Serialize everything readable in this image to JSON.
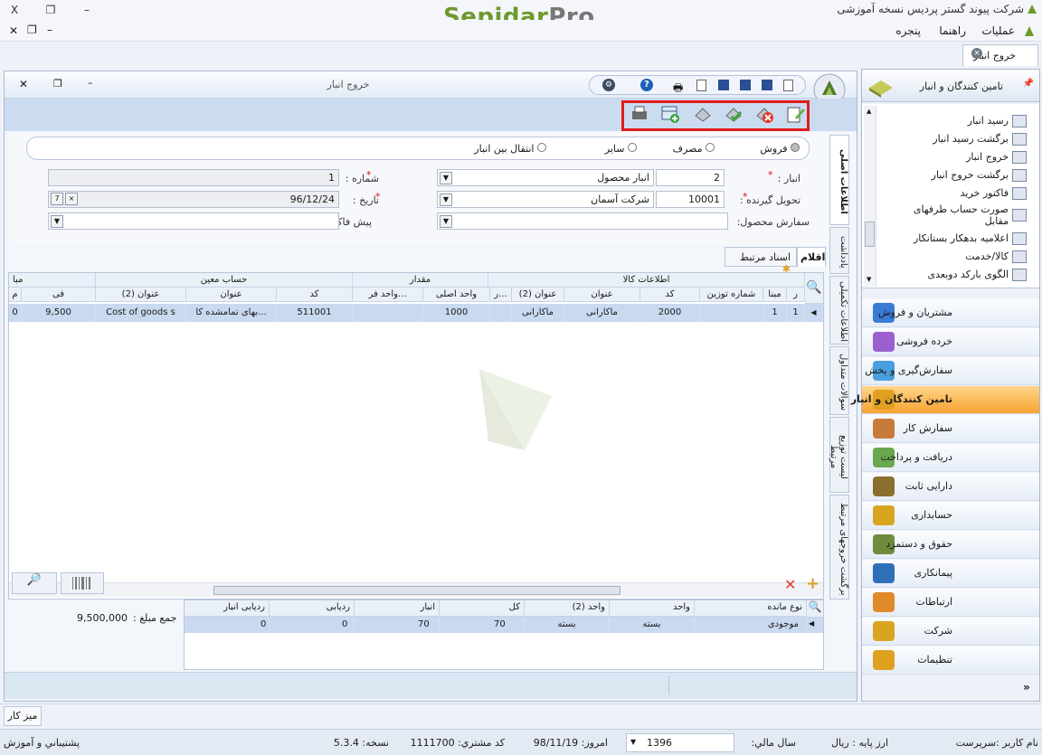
{
  "app": {
    "title": "شرکت پیوند گستر پردیس نسخه آموزشی",
    "logo_main": "Sepidar",
    "logo_suffix": "Pro",
    "win_controls": [
      "X",
      "❐",
      "–"
    ]
  },
  "menu": [
    "عملیات",
    "راهنما",
    "پنجره"
  ],
  "doc_tab": {
    "label": "خروج انبار"
  },
  "child": {
    "title": "خروج انبار",
    "mode_options": [
      "فروش",
      "مصرف",
      "سایر",
      "انتقال بین انبار"
    ],
    "form": {
      "warehouse_label": "انبار :",
      "warehouse_code": "2",
      "warehouse_name": "انبار محصول",
      "receiver_label": "تحویل گیرنده :",
      "receiver_code": "10001",
      "receiver_name": "شرکت آسمان",
      "order_label": "سفارش محصول:",
      "number_label": "شماره :",
      "number_value": "1",
      "date_label": "تاریخ :",
      "date_value": "96/12/24",
      "proforma_label": "پیش فاکتور"
    },
    "subtabs": {
      "items": "اقلام",
      "related_docs": "اسناد مرتبط"
    },
    "grid": {
      "group_headers": [
        "اطلاعات کالا",
        "مقدار",
        "حساب معین",
        "مبا"
      ],
      "columns": [
        "ر",
        "مبنا",
        "شماره توزین",
        "کد",
        "عنوان",
        "عنوان (2)",
        "ر...",
        "واحد اصلی",
        "واحد فر...",
        "کد",
        "عنوان",
        "عنوان (2)",
        "فی",
        "م"
      ],
      "rows": [
        {
          "r": "1",
          "mabna": "1",
          "tozin": "",
          "code": "2000",
          "title": "ماکارانی",
          "title2": "ماکارانی",
          "r2": "",
          "unit_main": "1000",
          "unit_sub": "",
          "acc_code": "511001",
          "acc_title": "بهای تمامشده کا...",
          "acc_title2": "Cost of goods s",
          "price": "9,500",
          "m": "0"
        }
      ]
    },
    "vertical_tabs": [
      "اطلاعات اصلی",
      "یادداشت",
      "اطلاعات تکمیلی",
      "سوالات متداول",
      "لیست توزیع مرتبط",
      "برگشت خروجهای مرتبط"
    ],
    "total_label": "جمع مبلغ :",
    "total_value": "9,500,000",
    "detail": {
      "columns": [
        "نوع مانده",
        "واحد",
        "واحد (2)",
        "کل",
        "انبار",
        "ردیابی",
        "ردیابی انبار"
      ],
      "row": [
        "موجودی",
        "بسته",
        "بسته",
        "70",
        "70",
        "0",
        "0"
      ]
    }
  },
  "nav": {
    "header": "تامین کنندگان و انبار",
    "tree": [
      "رسید انبار",
      "برگشت رسید انبار",
      "خروج انبار",
      "برگشت خروج انبار",
      "فاکتور خرید",
      "صورت حساب طرفهای مقابل",
      "اعلامیه بدهکار بستانکار",
      "کالا/خدمت",
      "الگوی بارکد دوبعدی"
    ],
    "items": [
      "مشتریان و فروش",
      "خرده فروشی",
      "سفارش‌گیری و پخش",
      "تامین کنندگان و انبار",
      "سفارش کار",
      "دریافت و پرداخت",
      "دارایی ثابت",
      "حسابداری",
      "حقوق و دستمزد",
      "پیمانکاری",
      "ارتباطات",
      "شرکت",
      "تنظیمات"
    ],
    "active": 3,
    "icon_colors": [
      "#3b7bd6",
      "#9c5fd0",
      "#4aa0de",
      "#e0a020",
      "#c77b3a",
      "#6aa84f",
      "#8a6f2e",
      "#d9a521",
      "#6f8b3e",
      "#2f6fb8",
      "#e08a2a",
      "#d9a521",
      "#e0a020"
    ]
  },
  "desk": {
    "label": "میز کار"
  },
  "status": {
    "user": "نام کاربر :سرپرست",
    "currency": "ارز پایه :  ریال",
    "fiscal_label": "سال مالي:",
    "fiscal_value": "1396",
    "today": "امروز:    98/11/19",
    "customer_code": "کد مشتري:    1111700",
    "version": "نسخه:    5.3.4",
    "support": "پشتيباني و آموزش"
  }
}
